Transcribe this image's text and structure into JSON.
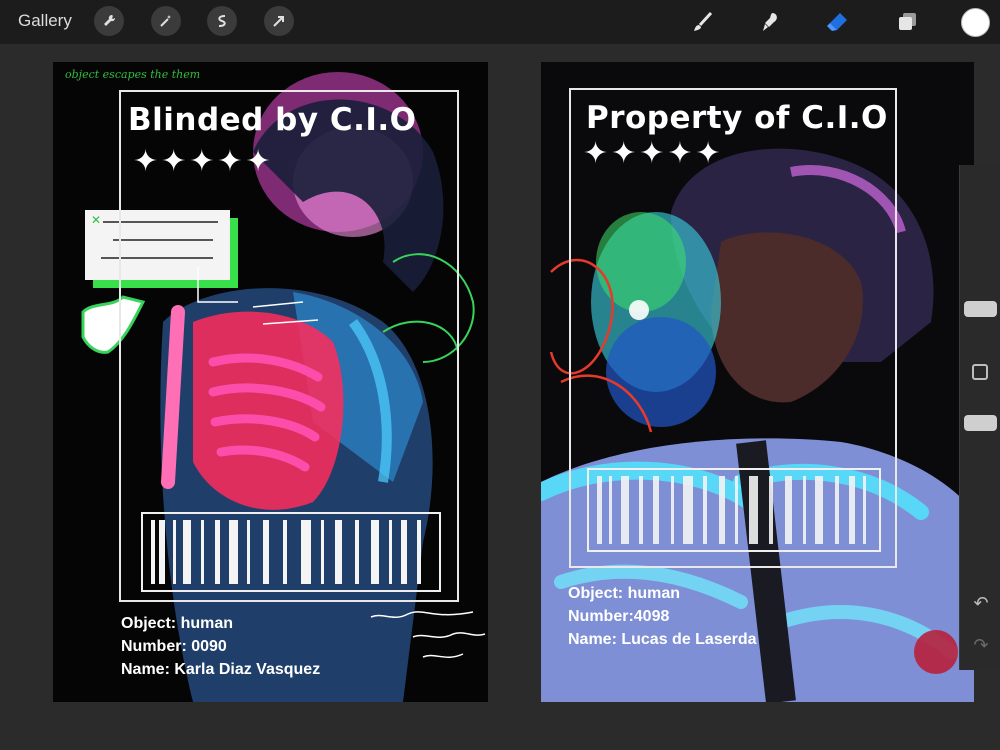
{
  "toolbar": {
    "gallery_label": "Gallery",
    "left_tools": [
      "wrench-icon",
      "magic-wand-icon",
      "selection-icon",
      "transform-arrow-icon"
    ],
    "right_tools": [
      "brush-icon",
      "smudge-icon",
      "eraser-icon",
      "layers-icon"
    ],
    "active_tool": "eraser-icon",
    "accent_color": "#1f6fe0",
    "current_color": "#ffffff"
  },
  "canvas": {
    "card_left": {
      "title": "Blinded by C.I.O",
      "stars": "✦✦✦✦✦",
      "info": {
        "object": "Object: human",
        "number": "Number: 0090",
        "name": "Name: Karla Diaz Vasquez"
      },
      "sketch_note": "object escapes the them"
    },
    "card_right": {
      "title": "Property of C.I.O",
      "stars": "✦✦✦✦✦",
      "info": {
        "object": "Object: human",
        "number": "Number:4098",
        "name": "Name: Lucas de Laserda"
      }
    }
  },
  "sidebar": {
    "icons": [
      "brush-size-slider",
      "modify-button",
      "opacity-slider",
      "undo-icon",
      "redo-icon"
    ]
  }
}
